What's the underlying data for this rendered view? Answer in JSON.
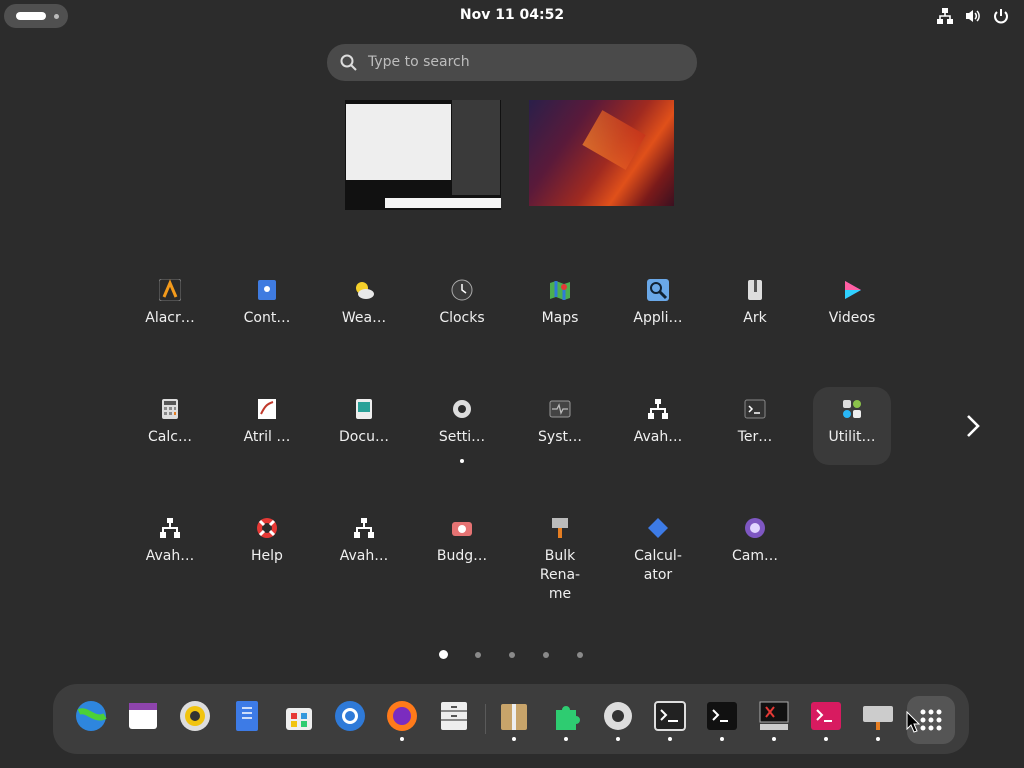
{
  "topbar": {
    "clock": "Nov 11  04:52"
  },
  "search": {
    "placeholder": "Type to search"
  },
  "apps": [
    {
      "label": "Alacr…",
      "icon": "alacritty-icon"
    },
    {
      "label": "Cont…",
      "icon": "contacts-icon"
    },
    {
      "label": "Wea…",
      "icon": "weather-icon"
    },
    {
      "label": "Clocks",
      "icon": "clocks-icon"
    },
    {
      "label": "Maps",
      "icon": "maps-icon"
    },
    {
      "label": "Appli…",
      "icon": "application-finder-icon"
    },
    {
      "label": "Ark",
      "icon": "ark-icon"
    },
    {
      "label": "Videos",
      "icon": "videos-icon"
    },
    {
      "label": "Calc…",
      "icon": "calculator-icon"
    },
    {
      "label": "Atril …",
      "icon": "atril-icon"
    },
    {
      "label": "Docu…",
      "icon": "document-viewer-icon"
    },
    {
      "label": "Setti…",
      "icon": "settings-gear-icon"
    },
    {
      "label": "Syst…",
      "icon": "system-monitor-icon"
    },
    {
      "label": "Avah…",
      "icon": "network-icon"
    },
    {
      "label": "Ter…",
      "icon": "terminal-icon"
    },
    {
      "label": "Utilit…",
      "icon": "utilities-folder-icon"
    },
    {
      "label": "Avah…",
      "icon": "network-icon"
    },
    {
      "label": "Help",
      "icon": "help-lifebuoy-icon"
    },
    {
      "label": "Avah…",
      "icon": "network-icon"
    },
    {
      "label": "Budg…",
      "icon": "budgie-screenshot-icon"
    },
    {
      "label": "Bulk\nRena-\nme",
      "icon": "bulk-rename-icon"
    },
    {
      "label": "Calcul-\nator",
      "icon": "calculator-diamond-icon"
    },
    {
      "label": "Cam…",
      "icon": "camera-icon"
    }
  ],
  "pagination": {
    "count": 5,
    "current": 1
  },
  "dock": [
    "browser-globe-icon",
    "calendar-icon",
    "rhythmbox-icon",
    "text-editor-icon",
    "software-store-icon",
    "chromium-icon",
    "firefox-icon",
    "file-cabinet-icon",
    "archive-manager-icon",
    "extensions-puzzle-icon",
    "settings-gear-icon",
    "terminal-icon",
    "console-icon",
    "xterm-icon",
    "terminal-red-icon",
    "keyboard-icon"
  ],
  "colors": {
    "background": "#2c2c2c",
    "dock": "#3d3d3d",
    "search": "#4a4a4a"
  }
}
